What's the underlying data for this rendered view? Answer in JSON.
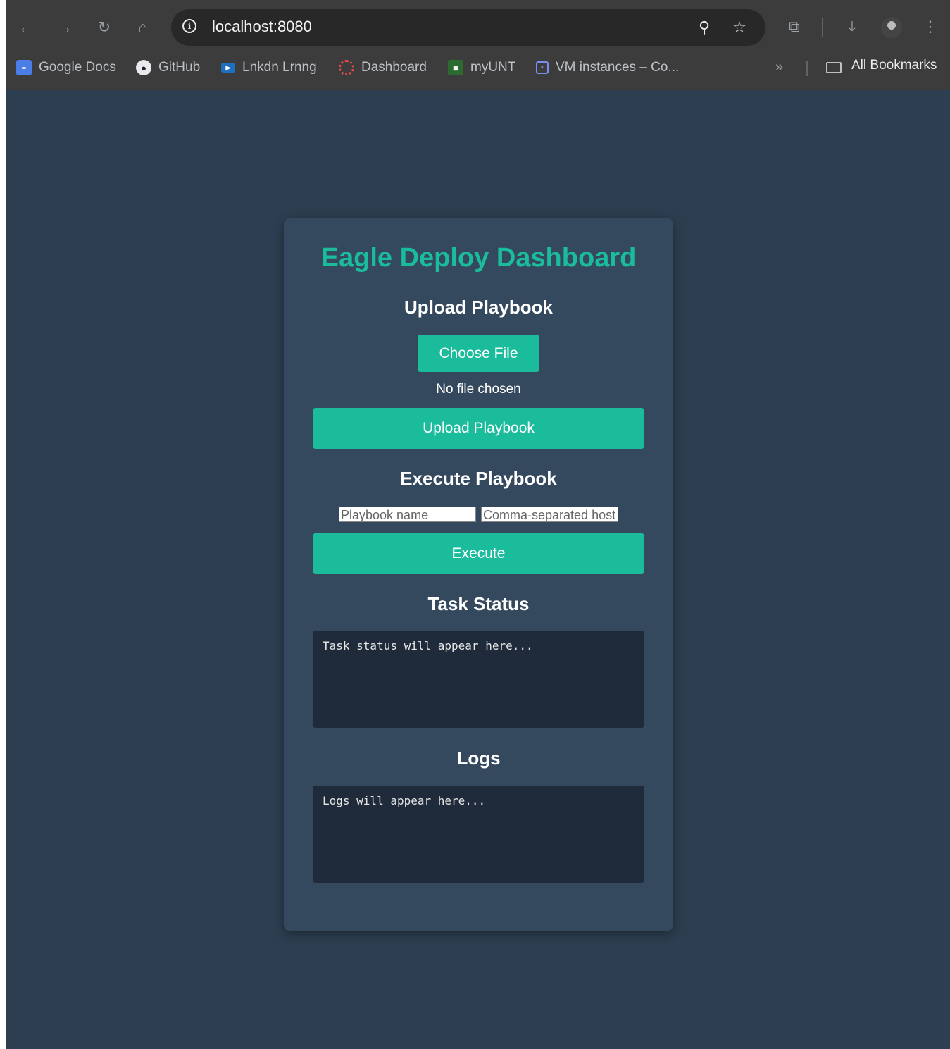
{
  "browser": {
    "url": "localhost:8080",
    "bookmarks": [
      {
        "label": "Google Docs",
        "icon": "google-docs-icon"
      },
      {
        "label": "GitHub",
        "icon": "github-icon"
      },
      {
        "label": "Lnkdn Lrnng",
        "icon": "linkedin-learning-icon"
      },
      {
        "label": "Dashboard",
        "icon": "dashboard-icon"
      },
      {
        "label": "myUNT",
        "icon": "myunt-icon"
      },
      {
        "label": "VM instances – Co...",
        "icon": "vm-instances-icon"
      }
    ],
    "all_bookmarks": "All Bookmarks"
  },
  "page": {
    "title": "Eagle Deploy Dashboard",
    "upload": {
      "heading": "Upload Playbook",
      "choose_file": "Choose File",
      "no_file": "No file chosen",
      "button": "Upload Playbook"
    },
    "execute": {
      "heading": "Execute Playbook",
      "playbook_placeholder": "Playbook name",
      "hosts_placeholder": "Comma-separated host",
      "button": "Execute"
    },
    "status": {
      "heading": "Task Status",
      "text": "Task status will appear here..."
    },
    "logs": {
      "heading": "Logs",
      "text": "Logs will appear here..."
    }
  },
  "colors": {
    "background": "#2c3e50",
    "card": "#34495e",
    "accent": "#1abc9c",
    "output_box": "#1f2b3a"
  }
}
